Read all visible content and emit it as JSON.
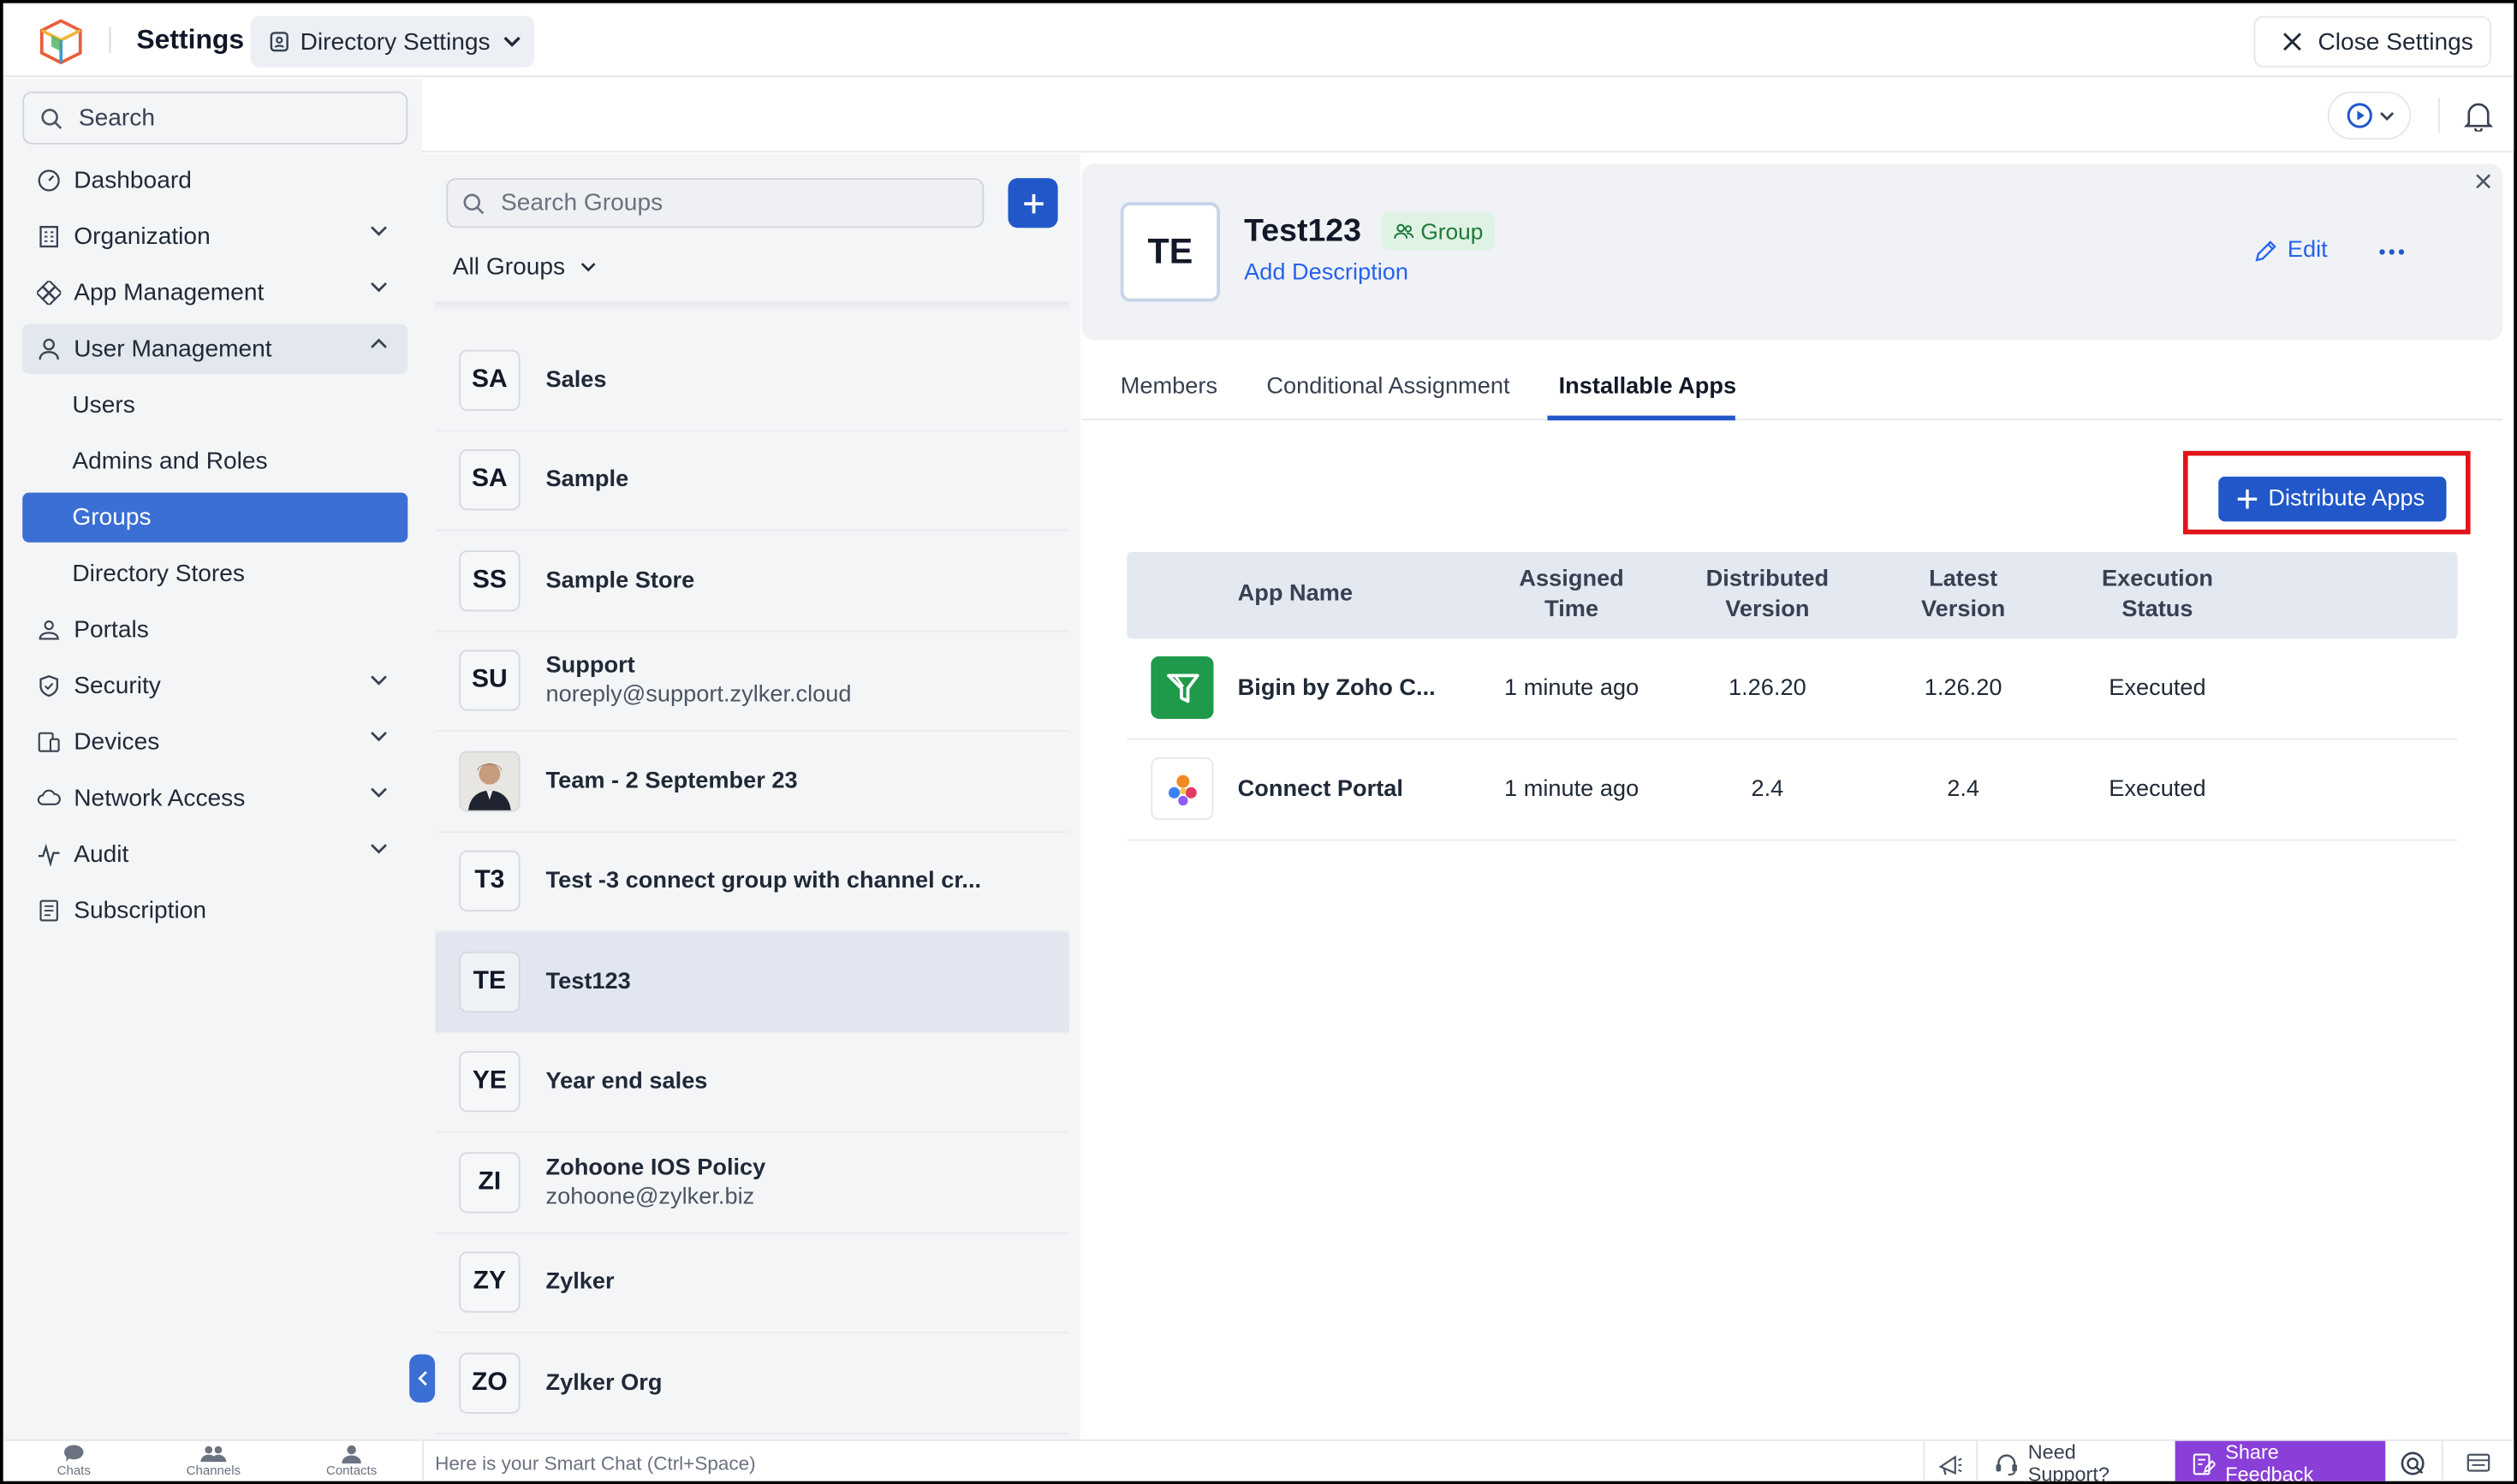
{
  "topbar": {
    "title": "Settings",
    "directory_label": "Directory Settings",
    "close_label": "Close Settings"
  },
  "sidebar": {
    "search_placeholder": "Search",
    "items": [
      {
        "label": "Dashboard",
        "icon": "dashboard-icon"
      },
      {
        "label": "Organization",
        "icon": "organization-icon"
      },
      {
        "label": "App Management",
        "icon": "app-management-icon"
      },
      {
        "label": "User Management",
        "icon": "user-icon"
      },
      {
        "label": "Users"
      },
      {
        "label": "Admins and Roles"
      },
      {
        "label": "Groups"
      },
      {
        "label": "Directory Stores"
      },
      {
        "label": "Portals",
        "icon": "portals-icon"
      },
      {
        "label": "Security",
        "icon": "shield-icon"
      },
      {
        "label": "Devices",
        "icon": "devices-icon"
      },
      {
        "label": "Network Access",
        "icon": "network-icon"
      },
      {
        "label": "Audit",
        "icon": "audit-icon"
      },
      {
        "label": "Subscription",
        "icon": "subscription-icon"
      }
    ]
  },
  "groups": {
    "search_placeholder": "Search Groups",
    "filter_label": "All Groups",
    "items": [
      {
        "initials": "SA",
        "name": "Sales",
        "email": ""
      },
      {
        "initials": "SA",
        "name": "Sample",
        "email": ""
      },
      {
        "initials": "SS",
        "name": "Sample Store",
        "email": ""
      },
      {
        "initials": "SU",
        "name": "Support",
        "email": "noreply@support.zylker.cloud"
      },
      {
        "initials": "",
        "name": "Team - 2 September 23",
        "email": ""
      },
      {
        "initials": "T3",
        "name": "Test -3 connect group with channel cr...",
        "email": ""
      },
      {
        "initials": "TE",
        "name": "Test123",
        "email": ""
      },
      {
        "initials": "YE",
        "name": "Year end sales",
        "email": ""
      },
      {
        "initials": "ZI",
        "name": "Zohoone IOS Policy",
        "email": "zohoone@zylker.biz"
      },
      {
        "initials": "ZY",
        "name": "Zylker",
        "email": ""
      },
      {
        "initials": "ZO",
        "name": "Zylker Org",
        "email": ""
      }
    ]
  },
  "detail": {
    "initials": "TE",
    "title": "Test123",
    "badge": "Group",
    "description_link": "Add Description",
    "edit_label": "Edit",
    "tabs": [
      "Members",
      "Conditional Assignment",
      "Installable Apps"
    ],
    "active_tab": "Installable Apps",
    "distribute_label": "Distribute Apps",
    "table": {
      "headers": {
        "app_name": "App Name",
        "assigned_1": "Assigned",
        "assigned_2": "Time",
        "distributed_1": "Distributed",
        "distributed_2": "Version",
        "latest_1": "Latest",
        "latest_2": "Version",
        "status_1": "Execution",
        "status_2": "Status"
      },
      "rows": [
        {
          "app": "Bigin by Zoho C...",
          "assigned": "1 minute ago",
          "distributed": "1.26.20",
          "latest": "1.26.20",
          "status": "Executed",
          "icon": "bigin-app-icon"
        },
        {
          "app": "Connect Portal",
          "assigned": "1 minute ago",
          "distributed": "2.4",
          "latest": "2.4",
          "status": "Executed",
          "icon": "connect-portal-icon"
        }
      ]
    }
  },
  "bottombar": {
    "chats": "Chats",
    "channels": "Channels",
    "contacts": "Contacts",
    "smart_chat_placeholder": "Here is your Smart Chat (Ctrl+Space)",
    "need_support": "Need Support?",
    "share_feedback": "Share Feedback"
  },
  "colors": {
    "accent": "#2157c9",
    "active_nav": "#3b6fd4",
    "highlight_box": "#e0151a",
    "feedback": "#8b3fd9"
  }
}
